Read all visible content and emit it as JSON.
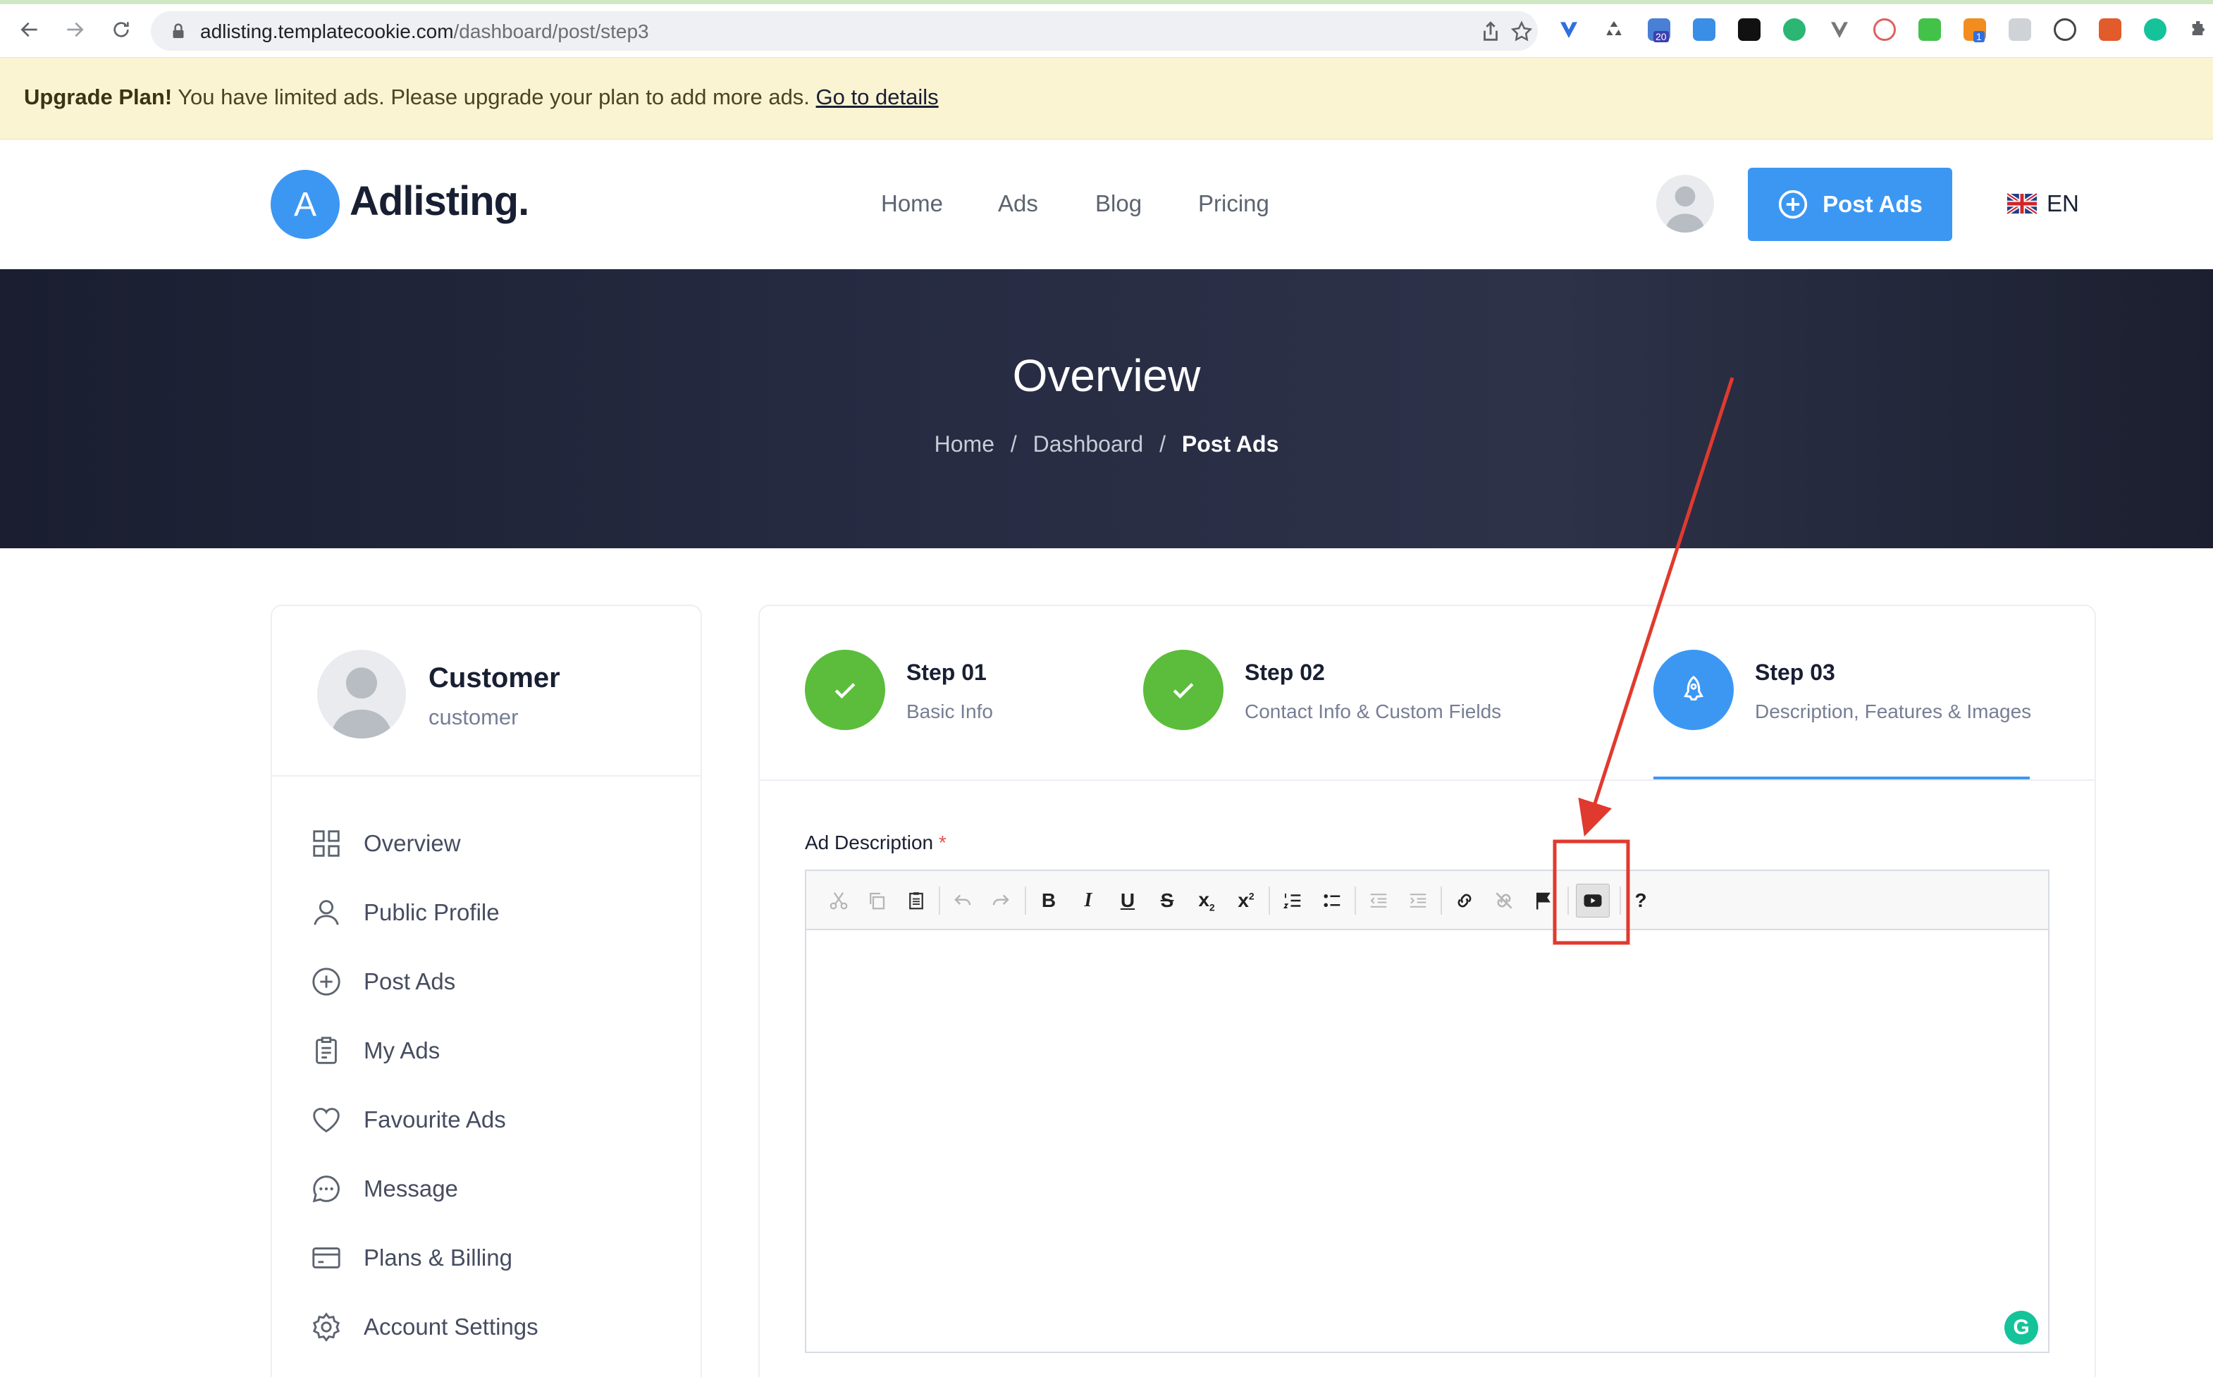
{
  "browser": {
    "url_host": "adlisting.templatecookie.com",
    "url_path": "/dashboard/post/step3",
    "extension_badges": [
      "20",
      "1"
    ]
  },
  "banner": {
    "bold": "Upgrade Plan!",
    "text": " You have limited ads. Please upgrade your plan to add more ads. ",
    "link": "Go to details"
  },
  "header": {
    "logo_letter": "A",
    "logo_text": "Adlisting.",
    "menu": [
      "Home",
      "Ads",
      "Blog",
      "Pricing"
    ],
    "post_button": "Post Ads",
    "language": "EN"
  },
  "hero": {
    "title": "Overview",
    "breadcrumb": [
      "Home",
      "Dashboard",
      "Post Ads"
    ],
    "separator": "/"
  },
  "sidebar": {
    "name": "Customer",
    "role": "customer",
    "items": [
      {
        "label": "Overview",
        "icon": "grid-icon"
      },
      {
        "label": "Public Profile",
        "icon": "user-icon"
      },
      {
        "label": "Post Ads",
        "icon": "plus-circle-icon"
      },
      {
        "label": "My Ads",
        "icon": "clipboard-icon"
      },
      {
        "label": "Favourite Ads",
        "icon": "heart-icon"
      },
      {
        "label": "Message",
        "icon": "chat-icon"
      },
      {
        "label": "Plans & Billing",
        "icon": "card-icon"
      },
      {
        "label": "Account Settings",
        "icon": "gear-icon"
      }
    ]
  },
  "steps": [
    {
      "title": "Step 01",
      "subtitle": "Basic Info",
      "state": "done"
    },
    {
      "title": "Step 02",
      "subtitle": "Contact Info & Custom Fields",
      "state": "done"
    },
    {
      "title": "Step 03",
      "subtitle": "Description, Features & Images",
      "state": "active"
    }
  ],
  "editor": {
    "label": "Ad Description",
    "required_mark": "*",
    "help_glyph": "?"
  },
  "colors": {
    "accent": "#3c97f3",
    "success": "#5bbd3b",
    "annotation": "#e03a2e",
    "banner_bg": "#fbf4d3"
  }
}
